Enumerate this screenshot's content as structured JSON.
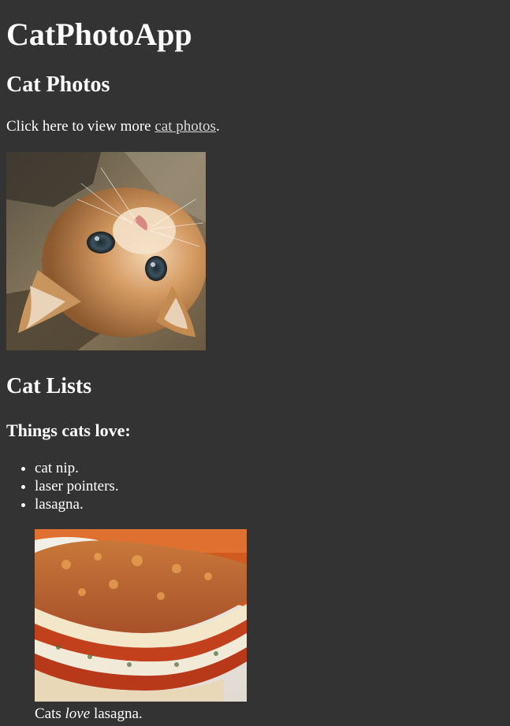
{
  "app_title": "CatPhotoApp",
  "photos_section": {
    "heading": "Cat Photos",
    "more_prefix": "Click here to view more ",
    "more_link": "cat photos",
    "more_suffix": ".",
    "image_alt": "A cute orange cat lying on its back."
  },
  "lists_section": {
    "heading": "Cat Lists",
    "subheading": "Things cats love:",
    "items": [
      "cat nip.",
      "laser pointers.",
      "lasagna."
    ],
    "figure_alt": "A slice of lasagna on a plate.",
    "caption_before": "Cats ",
    "caption_emphasis": "love",
    "caption_after": " lasagna."
  }
}
